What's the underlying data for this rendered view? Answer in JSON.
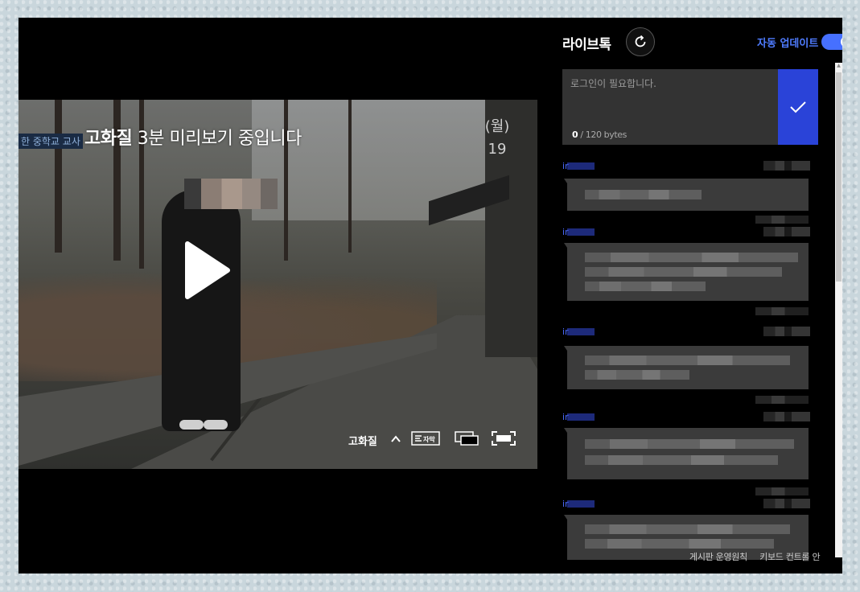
{
  "video": {
    "preview_bold": "고화질",
    "preview_text": "3분 미리보기 중입니다",
    "quality_label": "고화질",
    "subtitle_icon_label": "자막",
    "background_sign_left": "한 중학교 교사",
    "background_sign_right": "(월)\n19"
  },
  "sidebar": {
    "title": "라이브톡",
    "auto_update_label": "자동 업데이트",
    "auto_update_on": true,
    "input_placeholder": "로그인이 필요합니다.",
    "byte_current": "0",
    "byte_limit": "/ 120 bytes",
    "messages": [
      {
        "user_prefix": "ir"
      },
      {
        "user_prefix": "ir"
      },
      {
        "user_prefix": "ir"
      },
      {
        "user_prefix": "ir"
      },
      {
        "user_prefix": "ir"
      }
    ],
    "footer_links": [
      "게시판 운영원칙",
      "키보드 컨트롤 안"
    ]
  },
  "colors": {
    "accent": "#4670ff",
    "send_button": "#2a43d8",
    "panel": "#333333",
    "bubble": "#3b3b3b"
  }
}
